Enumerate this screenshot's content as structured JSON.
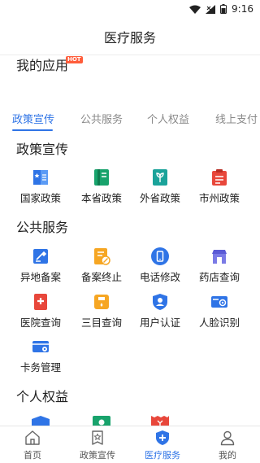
{
  "status_bar": {
    "time": "9:16"
  },
  "header": {
    "title": "医疗服务"
  },
  "my_apps": {
    "title": "我的应用",
    "badge": "HOT"
  },
  "tabs": [
    {
      "label": "政策宣传",
      "active": true
    },
    {
      "label": "公共服务",
      "active": false
    },
    {
      "label": "个人权益",
      "active": false
    },
    {
      "label": "线上支付",
      "active": false
    }
  ],
  "sections": {
    "policy": {
      "title": "政策宣传",
      "items": [
        {
          "label": "国家政策",
          "icon": "national-policy-icon"
        },
        {
          "label": "本省政策",
          "icon": "provincial-policy-icon"
        },
        {
          "label": "外省政策",
          "icon": "other-province-policy-icon"
        },
        {
          "label": "市州政策",
          "icon": "city-policy-icon"
        }
      ]
    },
    "public": {
      "title": "公共服务",
      "items": [
        {
          "label": "异地备案",
          "icon": "remote-filing-icon"
        },
        {
          "label": "备案终止",
          "icon": "filing-termination-icon"
        },
        {
          "label": "电话修改",
          "icon": "phone-change-icon"
        },
        {
          "label": "药店查询",
          "icon": "pharmacy-search-icon"
        },
        {
          "label": "医院查询",
          "icon": "hospital-search-icon"
        },
        {
          "label": "三目查询",
          "icon": "catalog-search-icon"
        },
        {
          "label": "用户认证",
          "icon": "user-auth-icon"
        },
        {
          "label": "人脸识别",
          "icon": "face-recognition-icon"
        },
        {
          "label": "卡务管理",
          "icon": "card-management-icon"
        }
      ]
    },
    "rights": {
      "title": "个人权益"
    }
  },
  "bottom_nav": [
    {
      "label": "首页",
      "icon": "home-icon",
      "active": false
    },
    {
      "label": "政策宣传",
      "icon": "policy-star-icon",
      "active": false
    },
    {
      "label": "医疗服务",
      "icon": "medical-shield-icon",
      "active": true
    },
    {
      "label": "我的",
      "icon": "profile-icon",
      "active": false
    }
  ],
  "colors": {
    "accent": "#2f74e6",
    "green": "#18a36c",
    "red": "#e8473b",
    "orange": "#f6a623",
    "purple": "#5b5bd6"
  }
}
